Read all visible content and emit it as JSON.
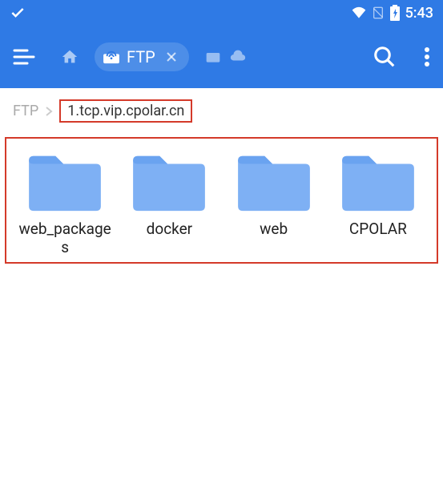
{
  "status": {
    "time": "5:43"
  },
  "header": {
    "tab_label": "FTP"
  },
  "breadcrumb": {
    "root": "FTP",
    "current": "1.tcp.vip.cpolar.cn"
  },
  "folders": [
    {
      "label": "web_packages"
    },
    {
      "label": "docker"
    },
    {
      "label": "web"
    },
    {
      "label": "CPOLAR"
    }
  ],
  "colors": {
    "accent": "#2f7ae5",
    "folder": "#7eb0f4",
    "highlight": "#d43a2a"
  }
}
